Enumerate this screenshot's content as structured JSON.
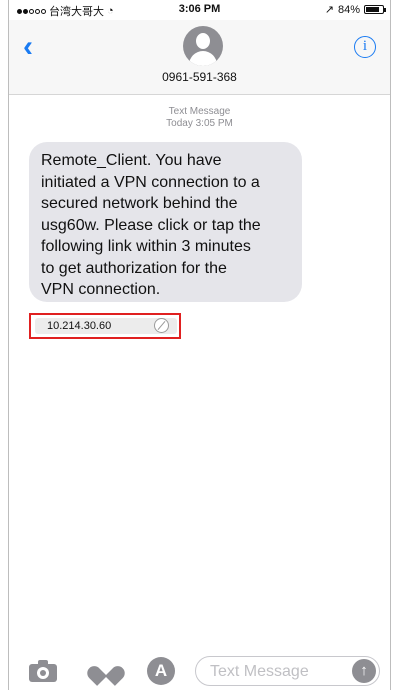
{
  "status_bar": {
    "carrier": "台湾大哥大",
    "wifi_icon": "wifi-icon",
    "time": "3:06 PM",
    "battery_percent": "84%",
    "battery_level": 0.84
  },
  "header": {
    "back_icon": "chevron-left-icon",
    "contact": "0961-591-368",
    "info_icon": "info-icon"
  },
  "conversation": {
    "meta_service": "Text Message",
    "meta_time": "Today 3:05 PM",
    "message_lines": [
      "Remote_Client. You have",
      "initiated a VPN connection to a",
      "secured network behind the",
      "usg60w. Please click or tap the",
      "following link within 3 minutes",
      "to get authorization for the",
      "VPN connection."
    ],
    "link": "10.214.30.60",
    "link_icon": "compass-icon"
  },
  "compose": {
    "camera_icon": "camera-icon",
    "digital_touch_icon": "heart-icon",
    "apps_icon": "app-store-icon",
    "placeholder": "Text Message",
    "send_icon": "send-arrow-icon"
  },
  "colors": {
    "accent": "#1a7bf2",
    "bubble": "#e5e5ea",
    "highlight": "#e02020"
  }
}
